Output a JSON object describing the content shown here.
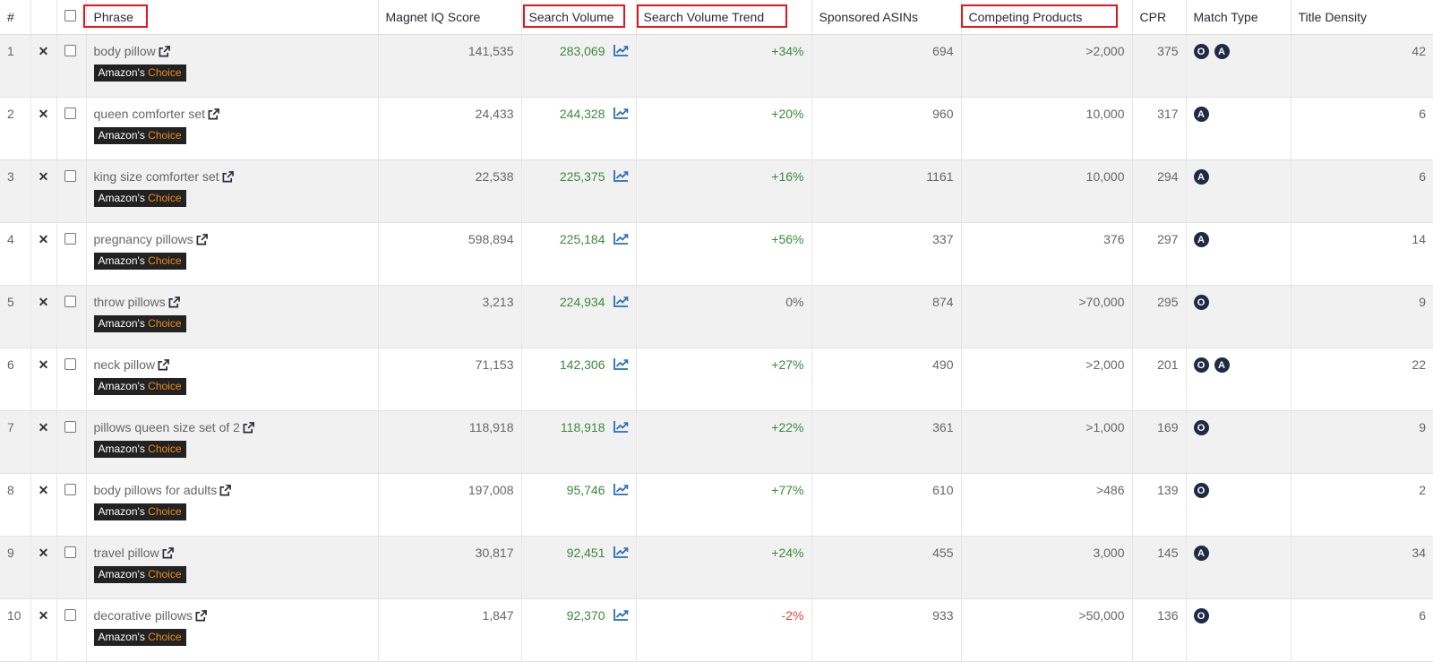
{
  "headers": {
    "index": "#",
    "phrase": "Phrase",
    "magnet_iq": "Magnet IQ Score",
    "search_volume": "Search Volume",
    "sv_trend": "Search Volume Trend",
    "sponsored_asins": "Sponsored ASINs",
    "competing_products": "Competing Products",
    "cpr": "CPR",
    "match_type": "Match Type",
    "title_density": "Title Density"
  },
  "badge": {
    "prefix": "Amazon's",
    "suffix": "Choice"
  },
  "colors": {
    "highlight": "#e8141b",
    "positive": "#3b8a3b",
    "negative": "#e0473a",
    "badge_bg": "#222222",
    "badge_accent": "#f08b1e",
    "icon_blue": "#2a6db5"
  },
  "rows": [
    {
      "index": "1",
      "phrase": "body pillow",
      "magnet_iq": "141,535",
      "search_volume": "283,069",
      "trend": "+34%",
      "trend_type": "positive",
      "sponsored_asins": "694",
      "competing": ">2,000",
      "cpr": "375",
      "match": [
        "O",
        "A"
      ],
      "title_density": "42"
    },
    {
      "index": "2",
      "phrase": "queen comforter set",
      "magnet_iq": "24,433",
      "search_volume": "244,328",
      "trend": "+20%",
      "trend_type": "positive",
      "sponsored_asins": "960",
      "competing": "10,000",
      "cpr": "317",
      "match": [
        "A"
      ],
      "title_density": "6"
    },
    {
      "index": "3",
      "phrase": "king size comforter set",
      "magnet_iq": "22,538",
      "search_volume": "225,375",
      "trend": "+16%",
      "trend_type": "positive",
      "sponsored_asins": "1161",
      "competing": "10,000",
      "cpr": "294",
      "match": [
        "A"
      ],
      "title_density": "6"
    },
    {
      "index": "4",
      "phrase": "pregnancy pillows",
      "magnet_iq": "598,894",
      "search_volume": "225,184",
      "trend": "+56%",
      "trend_type": "positive",
      "sponsored_asins": "337",
      "competing": "376",
      "cpr": "297",
      "match": [
        "A"
      ],
      "title_density": "14"
    },
    {
      "index": "5",
      "phrase": "throw pillows",
      "magnet_iq": "3,213",
      "search_volume": "224,934",
      "trend": "0%",
      "trend_type": "neutral",
      "sponsored_asins": "874",
      "competing": ">70,000",
      "cpr": "295",
      "match": [
        "O"
      ],
      "title_density": "9"
    },
    {
      "index": "6",
      "phrase": "neck pillow",
      "magnet_iq": "71,153",
      "search_volume": "142,306",
      "trend": "+27%",
      "trend_type": "positive",
      "sponsored_asins": "490",
      "competing": ">2,000",
      "cpr": "201",
      "match": [
        "O",
        "A"
      ],
      "title_density": "22"
    },
    {
      "index": "7",
      "phrase": "pillows queen size set of 2",
      "magnet_iq": "118,918",
      "search_volume": "118,918",
      "trend": "+22%",
      "trend_type": "positive",
      "sponsored_asins": "361",
      "competing": ">1,000",
      "cpr": "169",
      "match": [
        "O"
      ],
      "title_density": "9"
    },
    {
      "index": "8",
      "phrase": "body pillows for adults",
      "magnet_iq": "197,008",
      "search_volume": "95,746",
      "trend": "+77%",
      "trend_type": "positive",
      "sponsored_asins": "610",
      "competing": ">486",
      "cpr": "139",
      "match": [
        "O"
      ],
      "title_density": "2"
    },
    {
      "index": "9",
      "phrase": "travel pillow",
      "magnet_iq": "30,817",
      "search_volume": "92,451",
      "trend": "+24%",
      "trend_type": "positive",
      "sponsored_asins": "455",
      "competing": "3,000",
      "cpr": "145",
      "match": [
        "A"
      ],
      "title_density": "34"
    },
    {
      "index": "10",
      "phrase": "decorative pillows",
      "magnet_iq": "1,847",
      "search_volume": "92,370",
      "trend": "-2%",
      "trend_type": "negative",
      "sponsored_asins": "933",
      "competing": ">50,000",
      "cpr": "136",
      "match": [
        "O"
      ],
      "title_density": "6"
    }
  ]
}
